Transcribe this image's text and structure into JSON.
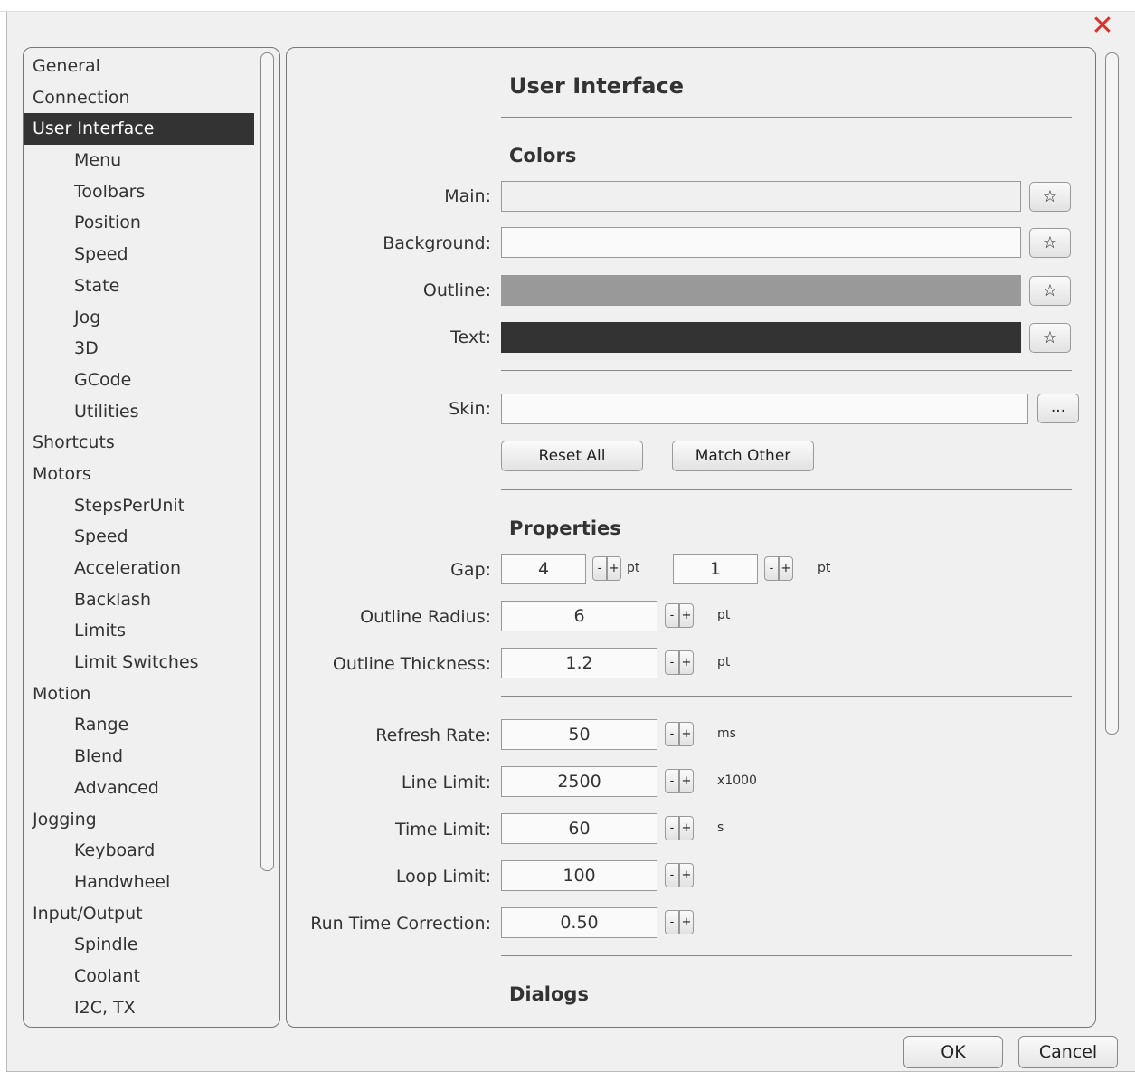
{
  "window": {
    "close_glyph": "✕"
  },
  "nav": {
    "items": [
      {
        "label": "General",
        "level": 0
      },
      {
        "label": "Connection",
        "level": 0
      },
      {
        "label": "User Interface",
        "level": 0,
        "selected": true
      },
      {
        "label": "Menu",
        "level": 1
      },
      {
        "label": "Toolbars",
        "level": 1
      },
      {
        "label": "Position",
        "level": 1
      },
      {
        "label": "Speed",
        "level": 1
      },
      {
        "label": "State",
        "level": 1
      },
      {
        "label": "Jog",
        "level": 1
      },
      {
        "label": "3D",
        "level": 1
      },
      {
        "label": "GCode",
        "level": 1
      },
      {
        "label": "Utilities",
        "level": 1
      },
      {
        "label": "Shortcuts",
        "level": 0
      },
      {
        "label": "Motors",
        "level": 0
      },
      {
        "label": "StepsPerUnit",
        "level": 1
      },
      {
        "label": "Speed",
        "level": 1
      },
      {
        "label": "Acceleration",
        "level": 1
      },
      {
        "label": "Backlash",
        "level": 1
      },
      {
        "label": "Limits",
        "level": 1
      },
      {
        "label": "Limit Switches",
        "level": 1
      },
      {
        "label": "Motion",
        "level": 0
      },
      {
        "label": "Range",
        "level": 1
      },
      {
        "label": "Blend",
        "level": 1
      },
      {
        "label": "Advanced",
        "level": 1
      },
      {
        "label": "Jogging",
        "level": 0
      },
      {
        "label": "Keyboard",
        "level": 1
      },
      {
        "label": "Handwheel",
        "level": 1
      },
      {
        "label": "Input/Output",
        "level": 0
      },
      {
        "label": "Spindle",
        "level": 1
      },
      {
        "label": "Coolant",
        "level": 1
      },
      {
        "label": "I2C, TX",
        "level": 1
      }
    ]
  },
  "panel": {
    "title": "User Interface",
    "colors": {
      "heading": "Colors",
      "main_label": "Main:",
      "background_label": "Background:",
      "outline_label": "Outline:",
      "text_label": "Text:",
      "star_glyph": "☆",
      "main_color": "#f0f0f0",
      "background_color": "#fafafa",
      "outline_color": "#999999",
      "text_color": "#333333"
    },
    "skin": {
      "label": "Skin:",
      "value": "",
      "browse_label": "...",
      "reset_all_label": "Reset All",
      "match_other_label": "Match Other"
    },
    "properties": {
      "heading": "Properties",
      "gap_label": "Gap:",
      "gap_value_1": "4",
      "gap_value_2": "1",
      "outline_radius_label": "Outline Radius:",
      "outline_radius_value": "6",
      "outline_thickness_label": "Outline Thickness:",
      "outline_thickness_value": "1.2",
      "refresh_rate_label": "Refresh Rate:",
      "refresh_rate_value": "50",
      "line_limit_label": "Line Limit:",
      "line_limit_value": "2500",
      "time_limit_label": "Time Limit:",
      "time_limit_value": "60",
      "loop_limit_label": "Loop Limit:",
      "loop_limit_value": "100",
      "run_time_correction_label": "Run Time Correction:",
      "run_time_correction_value": "0.50",
      "minus": "-",
      "plus": "+",
      "unit_pt": "pt",
      "unit_ms": "ms",
      "unit_x1000": "x1000",
      "unit_s": "s"
    },
    "dialogs": {
      "heading": "Dialogs"
    }
  },
  "footer": {
    "ok_label": "OK",
    "cancel_label": "Cancel"
  }
}
